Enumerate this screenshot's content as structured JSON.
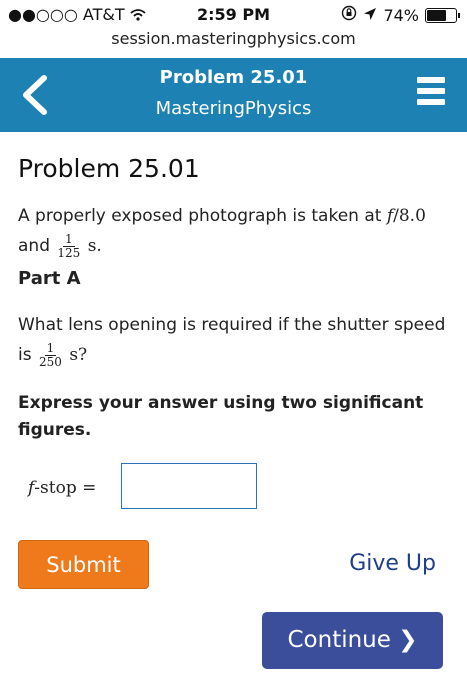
{
  "status_bar": {
    "carrier": "●●○○○ AT&T",
    "time": "2:59 PM",
    "battery": "74%",
    "battery_level": 0.74
  },
  "browser": {
    "url": "session.masteringphysics.com"
  },
  "header": {
    "title": "Problem 25.01",
    "subtitle": "MasteringPhysics"
  },
  "problem": {
    "title": "Problem 25.01",
    "intro_prefix": "A properly exposed photograph is taken at",
    "intro_fstop": "f",
    "intro_fstop_value": "/8.0",
    "intro_and": "and",
    "intro_frac_num": "1",
    "intro_frac_den": "125",
    "intro_unit": "s."
  },
  "part_a": {
    "label": "Part A",
    "question_prefix": "What lens opening is required if the shutter speed",
    "question_is": "is",
    "question_frac_num": "1",
    "question_frac_den": "250",
    "question_unit": "s?",
    "instruction": "Express your answer using two significant figures."
  },
  "answer": {
    "label_var": "f",
    "label_rest": "-stop =",
    "value": ""
  },
  "actions": {
    "submit": "Submit",
    "give_up": "Give Up",
    "continue": "Continue",
    "continue_arrow": "❯"
  },
  "colors": {
    "header_bg": "#1d82b3",
    "submit_bg": "#ee7a1c",
    "continue_bg": "#3a4e9c",
    "link": "#213e8a"
  }
}
